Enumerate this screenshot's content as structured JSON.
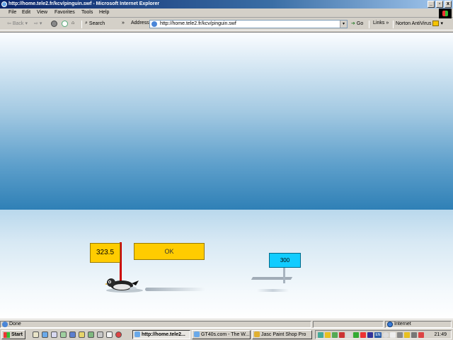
{
  "window": {
    "title": "http://home.tele2.fr/kcv/pinguin.swf - Microsoft Internet Explorer",
    "buttons": [
      "_",
      "▫",
      "x"
    ]
  },
  "menu": {
    "items": [
      "File",
      "Edit",
      "View",
      "Favorites",
      "Tools",
      "Help"
    ]
  },
  "toolbar": {
    "back_label": "Back",
    "search_label": "Search",
    "address_label": "Address",
    "address_value": "http://home.tele2.fr/kcv/pinguin.swf",
    "go_label": "Go",
    "links_label": "Links",
    "norton_label": "Norton AntiVirus"
  },
  "game": {
    "score": "323.5",
    "ok_label": "OK",
    "record": "300",
    "colors": {
      "sign_yellow": "#ffcc00",
      "record_cyan": "#11ccff",
      "pole_red": "#cc0000"
    }
  },
  "status": {
    "text": "Done",
    "zone": "Internet"
  },
  "taskbar": {
    "start_label": "Start",
    "tasks": [
      {
        "label": "http://home.tele2...",
        "active": true
      },
      {
        "label": "GT40s.com - The W...",
        "active": false
      },
      {
        "label": "Jasc Paint Shop Pro",
        "active": false
      }
    ],
    "tray_lang": "EN",
    "clock": "21:49"
  }
}
